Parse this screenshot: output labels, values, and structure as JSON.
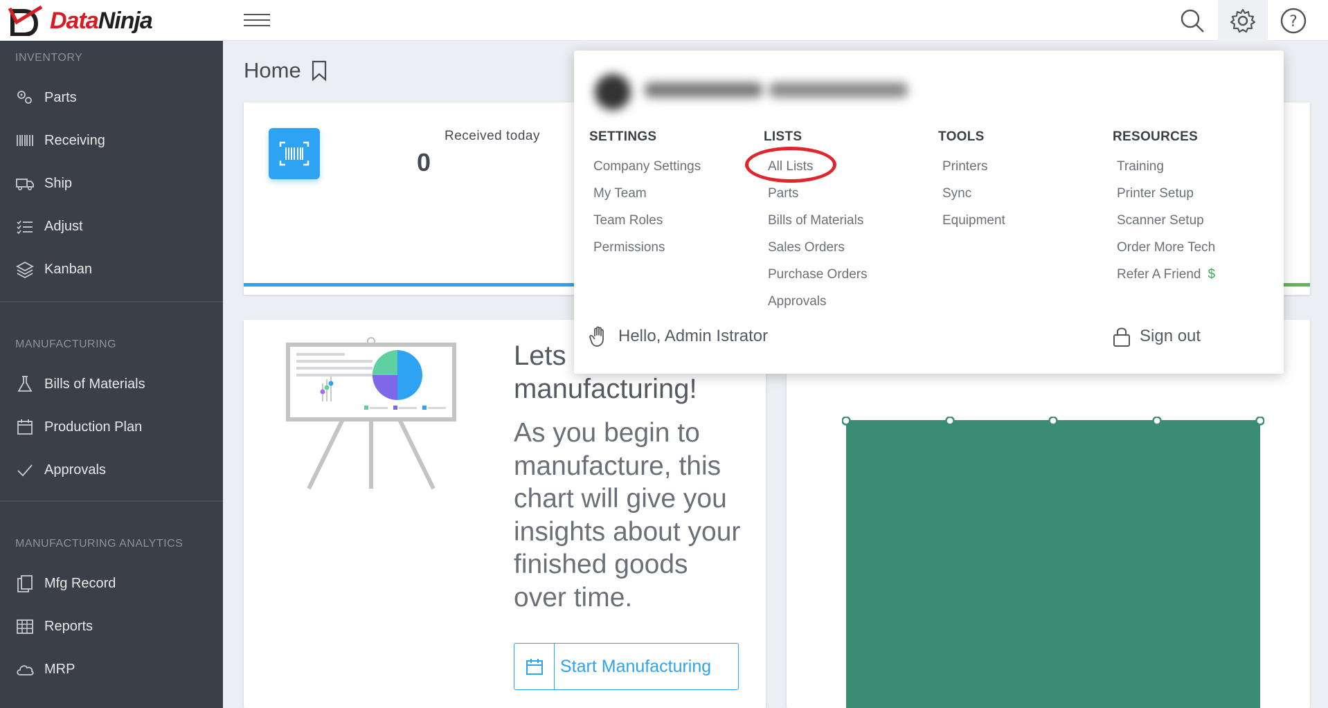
{
  "brand": {
    "logo_text_1": "Data",
    "logo_text_2": "Ninja",
    "accent": "#2ea3f2",
    "logo_red": "#d81c24"
  },
  "topbar": {
    "icons": [
      "search-icon",
      "gear-icon",
      "help-icon"
    ]
  },
  "sidebar": {
    "sections": [
      {
        "title": "INVENTORY",
        "items": [
          "Parts",
          "Receiving",
          "Ship",
          "Adjust",
          "Kanban"
        ]
      },
      {
        "title": "MANUFACTURING",
        "items": [
          "Bills of Materials",
          "Production Plan",
          "Approvals"
        ]
      },
      {
        "title": "MANUFACTURING ANALYTICS",
        "items": [
          "Mfg Record",
          "Reports",
          "MRP"
        ]
      }
    ]
  },
  "main": {
    "page_title": "Home",
    "stat_card": {
      "label": "Received today",
      "value": "0"
    },
    "promo": {
      "heading_1": "Lets",
      "heading_2": "manufacturing!",
      "body": "As you begin to manufacture, this chart will give you insights about your finished goods over time.",
      "button_label": "Start Manufacturing"
    }
  },
  "dropdown": {
    "columns": [
      {
        "title": "SETTINGS",
        "links": [
          "Company Settings",
          "My Team",
          "Team Roles",
          "Permissions"
        ]
      },
      {
        "title": "LISTS",
        "links": [
          "All Lists",
          "Parts",
          "Bills of Materials",
          "Sales Orders",
          "Purchase Orders",
          "Approvals"
        ]
      },
      {
        "title": "TOOLS",
        "links": [
          "Printers",
          "Sync",
          "Equipment"
        ]
      },
      {
        "title": "RESOURCES",
        "links": [
          "Training",
          "Printer Setup",
          "Scanner Setup",
          "Order More Tech",
          "Refer A Friend"
        ],
        "refer_symbol": "$"
      }
    ],
    "greeting": "Hello, Admin Istrator",
    "sign_out": "Sign out",
    "highlighted_item": "All Lists",
    "highlight_color": "#e0262c"
  },
  "chart_placeholder": {
    "fill": "#3a8d72"
  }
}
